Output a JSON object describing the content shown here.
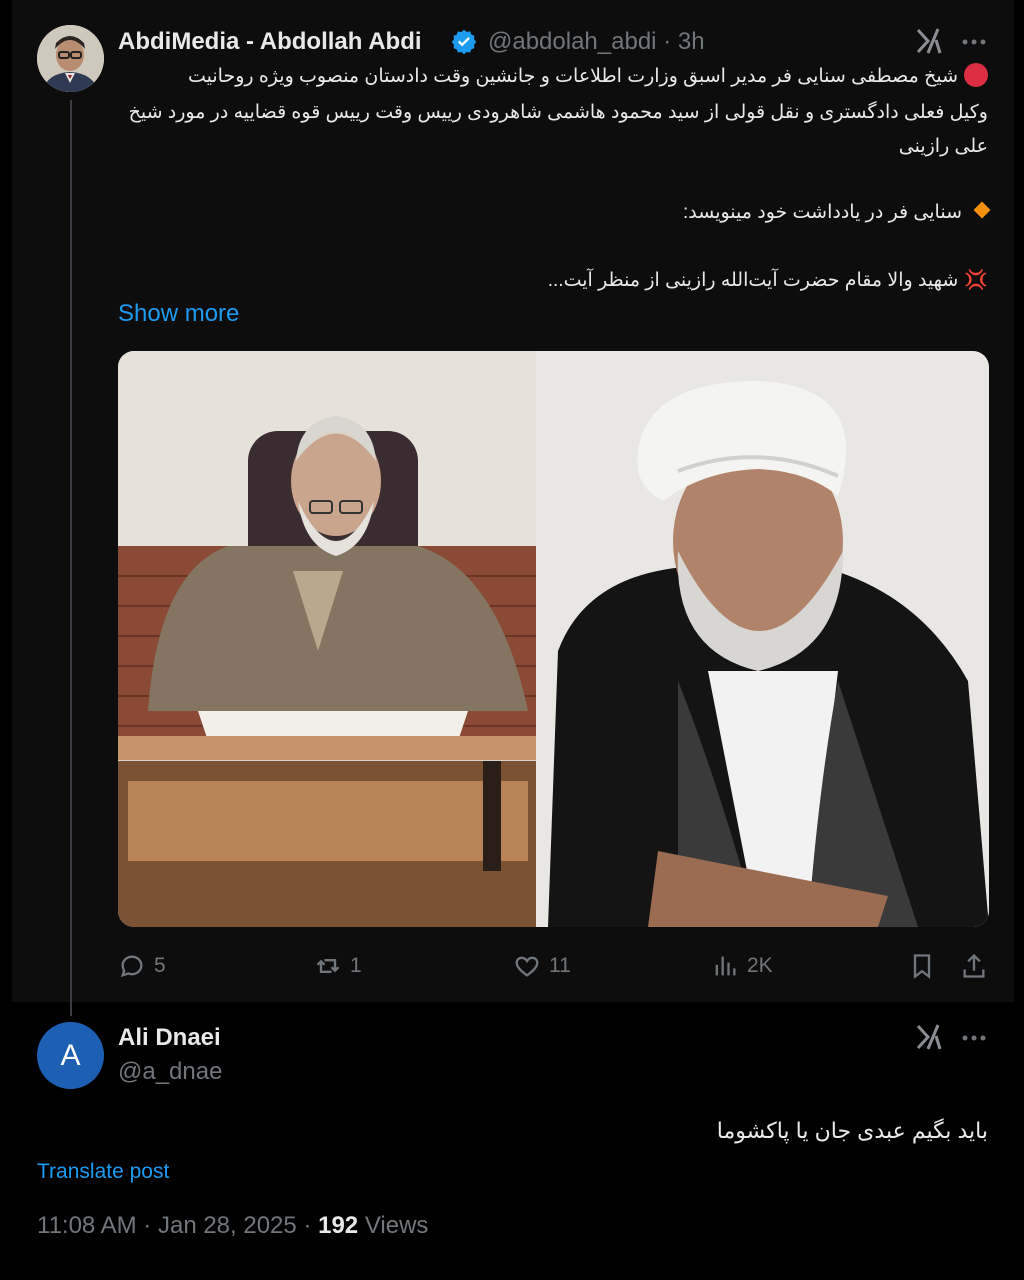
{
  "tweet": {
    "display_name": "AbdiMedia - Abdollah Abdi",
    "handle": "@abdolah_abdi",
    "time_ago": "3h",
    "line1": "شیخ مصطفی سنایی فر مدیر اسبق وزارت اطلاعات و جانشین وقت دادستان منصوب ویژه روحانیت",
    "line2": "وکیل فعلی دادگستری و نقل قولی از سید محمود هاشمی شاهرودی رییس وقت رییس قوه قضاییه در مورد شیخ",
    "line3": "علی رازینی",
    "line4": "سنایی فر در یادداشت خود مینویسد:",
    "line5": "شهید والا مقام حضرت آیت‌الله رازینی از منظر آیت...",
    "show_more": "Show more",
    "stats": {
      "replies": "5",
      "reposts": "1",
      "likes": "11",
      "views": "2K"
    }
  },
  "reply": {
    "avatar_letter": "A",
    "display_name": "Ali Dnaei",
    "handle": "@a_dnae",
    "text": "باید بگیم عبدی جان یا پاکشوما",
    "translate": "Translate post",
    "time": "11:08 AM",
    "date": "Jan 28, 2025",
    "views_count": "192",
    "views_label": "Views"
  },
  "icons": [
    "verified-badge-icon",
    "grok-icon",
    "more-options-icon",
    "reply-icon",
    "repost-icon",
    "like-icon",
    "views-icon",
    "bookmark-icon",
    "share-icon"
  ],
  "colors": {
    "accent": "#1d9bf0",
    "muted": "#71767b",
    "background": "#000000"
  }
}
